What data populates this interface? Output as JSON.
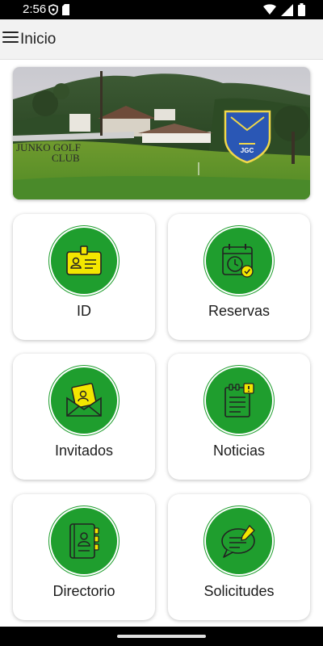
{
  "status": {
    "time": "2:56",
    "left_icons": [
      "shield-icon",
      "sd-card-icon"
    ],
    "right_icons": [
      "wifi-icon",
      "signal-icon",
      "battery-icon"
    ]
  },
  "appbar": {
    "title": "Inicio",
    "menu_icon": "hamburger-menu-icon"
  },
  "banner": {
    "sign_text_line1": "JUNKO GOLF",
    "sign_text_line2": "CLUB",
    "crest_letters": "JGC"
  },
  "tiles": [
    {
      "label": "ID",
      "icon": "id-card-icon"
    },
    {
      "label": "Reservas",
      "icon": "calendar-clock-icon"
    },
    {
      "label": "Invitados",
      "icon": "invitation-envelope-icon"
    },
    {
      "label": "Noticias",
      "icon": "news-notepad-icon"
    },
    {
      "label": "Directorio",
      "icon": "contact-book-icon"
    },
    {
      "label": "Solicitudes",
      "icon": "chat-request-icon"
    }
  ],
  "colors": {
    "accent": "#1f9e2e",
    "icon_yellow": "#f3e600",
    "statusbar": "#000000",
    "appbar": "#f2f2f2"
  }
}
